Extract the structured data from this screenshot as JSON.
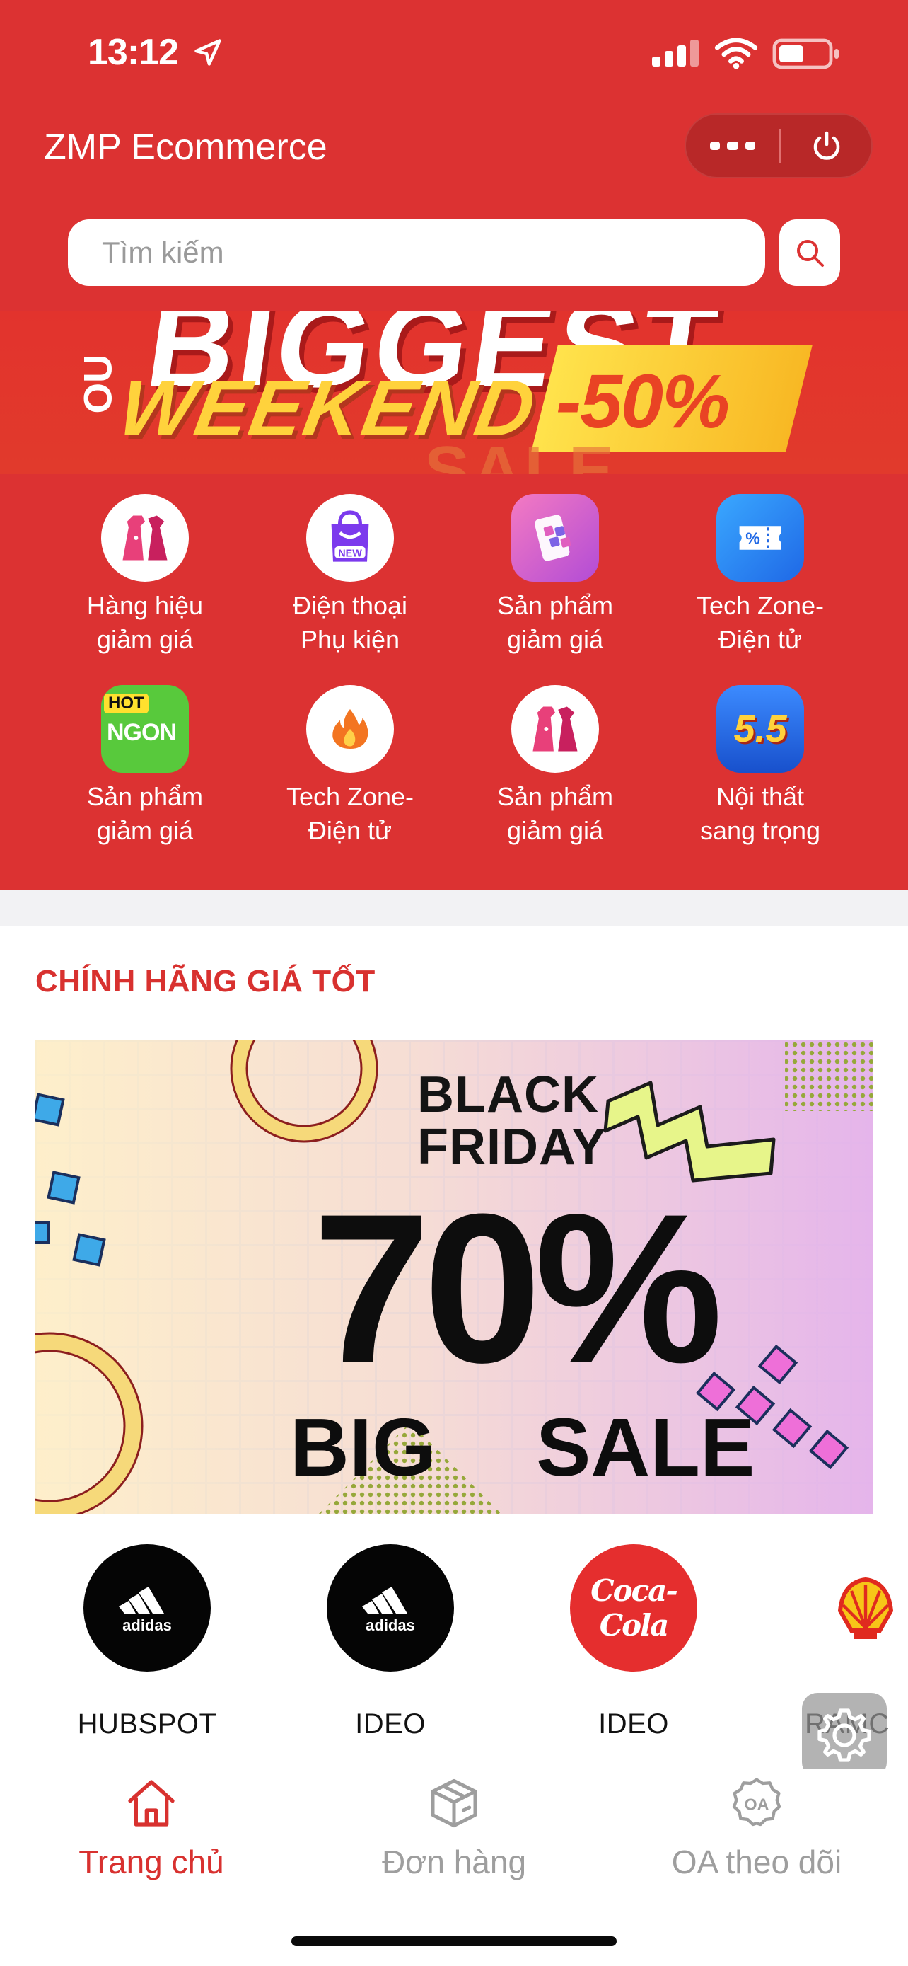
{
  "status_bar": {
    "time": "13:12"
  },
  "header": {
    "title": "ZMP Ecommerce",
    "search": {
      "placeholder": "Tìm kiếm"
    }
  },
  "hero_banner": {
    "line1": "BIGGEST",
    "side_text": "OU",
    "line2": "WEEKEND",
    "line3": "SALE",
    "discount": "-50%"
  },
  "categories": [
    {
      "label": "Hàng hiệu\ngiảm giá",
      "icon": "dress-icon"
    },
    {
      "label": "Điện thoại\nPhụ kiện",
      "icon": "new-bag-icon"
    },
    {
      "label": "Sản phẩm\ngiảm giá",
      "icon": "phone-apps-icon"
    },
    {
      "label": "Tech Zone-\nĐiện tử",
      "icon": "ticket-percent-icon"
    },
    {
      "label": "Sản phẩm\ngiảm giá",
      "icon": "hot-ngon-icon",
      "badge_top": "HOT",
      "badge_main": "NGON"
    },
    {
      "label": "Tech Zone-\nĐiện tử",
      "icon": "flame-icon"
    },
    {
      "label": "Sản phẩm\ngiảm giá",
      "icon": "dress-icon"
    },
    {
      "label": "Nội thất\nsang trọng",
      "icon": "sale-5-5-icon",
      "badge_main": "5.5"
    }
  ],
  "section": {
    "title": "CHÍNH HÃNG GIÁ TỐT"
  },
  "promo": {
    "line1": "BLACK",
    "line2": "FRIDAY",
    "percent": "70%",
    "big": "BIG",
    "sale": "SALE"
  },
  "brands": [
    {
      "name": "HUBSPOT",
      "logo": "adidas-logo",
      "logo_text": "adidas"
    },
    {
      "name": "IDEO",
      "logo": "adidas-logo",
      "logo_text": "adidas"
    },
    {
      "name": "IDEO",
      "logo": "coca-cola-logo",
      "logo_text": "Coca-Cola"
    },
    {
      "name": "RAMC",
      "logo": "shell-logo"
    }
  ],
  "tabs": [
    {
      "label": "Trang chủ",
      "icon": "home-icon",
      "active": true
    },
    {
      "label": "Đơn hàng",
      "icon": "package-icon",
      "active": false
    },
    {
      "label": "OA theo dõi",
      "icon": "oa-badge-icon",
      "active": false,
      "icon_text": "OA"
    }
  ],
  "colors": {
    "brand_red": "#dc3232",
    "active_tab": "#d8312f",
    "inactive_tab": "#9e9e9e",
    "section_title": "#d8312f"
  }
}
